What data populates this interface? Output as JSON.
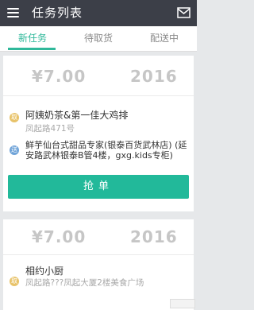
{
  "header": {
    "title": "任务列表"
  },
  "tabs": [
    {
      "label": "新任务",
      "active": true
    },
    {
      "label": "待取货",
      "active": false
    },
    {
      "label": "配送中",
      "active": false
    }
  ],
  "tasks": [
    {
      "price": "¥7.00",
      "distance": "2016",
      "shop_name": "阿姨奶茶&第一佳大鸡排",
      "shop_address": "凤起路471号",
      "dest_address": "鲜芋仙台式甜品专家(银泰百货武林店) (延安路武林银泰B管4楼，gxg.kids专柜)",
      "take_badge": "取",
      "send_badge": "送",
      "button_label": "抢单"
    },
    {
      "price": "¥7.00",
      "distance": "2016",
      "shop_name": "相约小厨",
      "shop_address": "凤起路???凤起大厦2楼美食广场",
      "take_badge": "取"
    }
  ],
  "colors": {
    "accent": "#2fb89a",
    "topbar": "#3c3f48",
    "button": "#22b99a"
  },
  "icons": {
    "menu": "hamburger-menu-icon",
    "mail": "envelope-icon"
  }
}
